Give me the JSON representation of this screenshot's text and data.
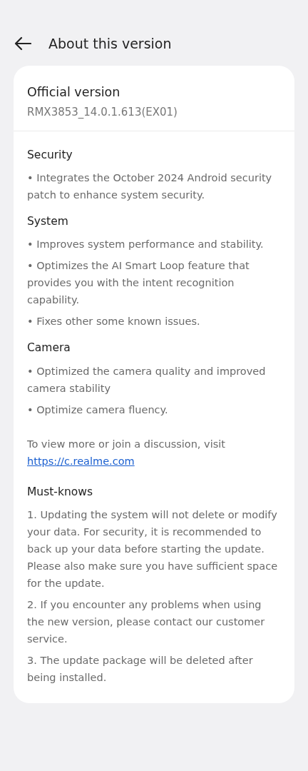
{
  "header": {
    "title": "About this version"
  },
  "version_card": {
    "title": "Official version",
    "version": "RMX3853_14.0.1.613(EX01)"
  },
  "sections": [
    {
      "heading": "Security",
      "items": [
        "• Integrates the October 2024 Android security patch to enhance system security."
      ]
    },
    {
      "heading": "System",
      "items": [
        "• Improves system performance and stability.",
        "• Optimizes the AI Smart Loop feature that provides you with the intent recognition capability.",
        "• Fixes other some known issues."
      ]
    },
    {
      "heading": "Camera",
      "items": [
        "• Optimized the camera quality and improved camera stability",
        "• Optimize camera fluency."
      ]
    }
  ],
  "discussion": {
    "text": "To view more or join a discussion, visit",
    "link": "https://c.realme.com"
  },
  "must_knows": {
    "heading": "Must-knows",
    "items": [
      "1. Updating the system will not delete or modify your data. For security, it is recommended to back up your data before starting the update. Please also make sure you have sufficient space for the update.",
      "2. If you encounter any problems when using the new version, please contact our customer service.",
      "3. The update package will be deleted after being installed."
    ]
  }
}
